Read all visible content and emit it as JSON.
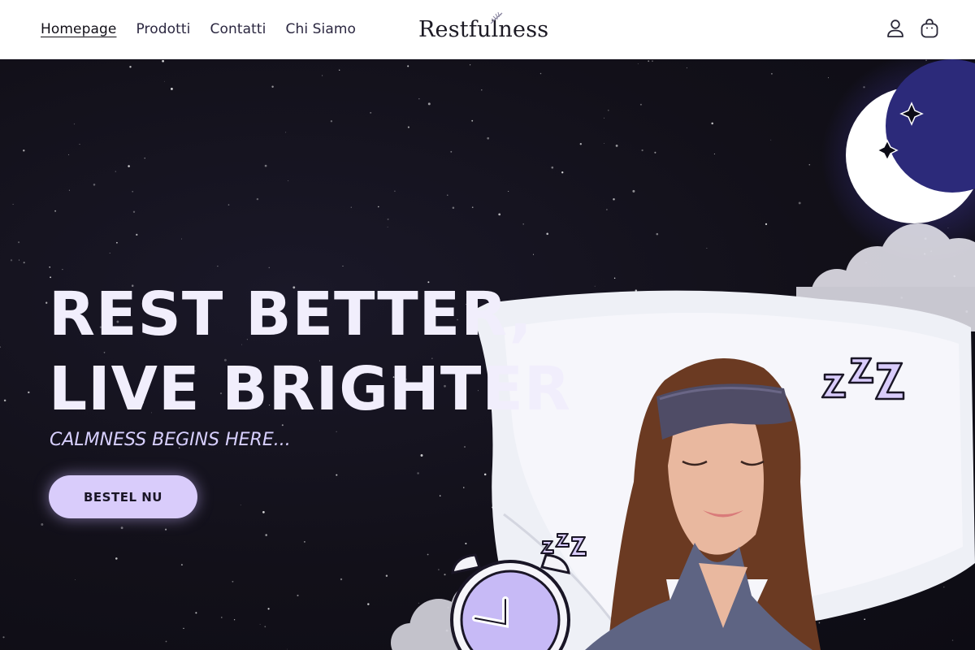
{
  "header": {
    "nav": [
      {
        "label": "Homepage",
        "active": true
      },
      {
        "label": "Prodotti"
      },
      {
        "label": "Contatti"
      },
      {
        "label": "Chi Siamo"
      }
    ],
    "logo_text": "Restfulness",
    "icons": [
      "account-icon",
      "shopping-bag-icon"
    ]
  },
  "hero": {
    "headline_line1": "REST BETTER,",
    "headline_line2": "LIVE BRIGHTER",
    "tagline": "CALMNESS BEGINS HERE...",
    "cta_label": "BESTEL NU"
  },
  "colors": {
    "hero_bg": "#13111f",
    "accent": "#d9ccfb",
    "headline": "#f1eefc",
    "tagline": "#d8d0ff"
  }
}
